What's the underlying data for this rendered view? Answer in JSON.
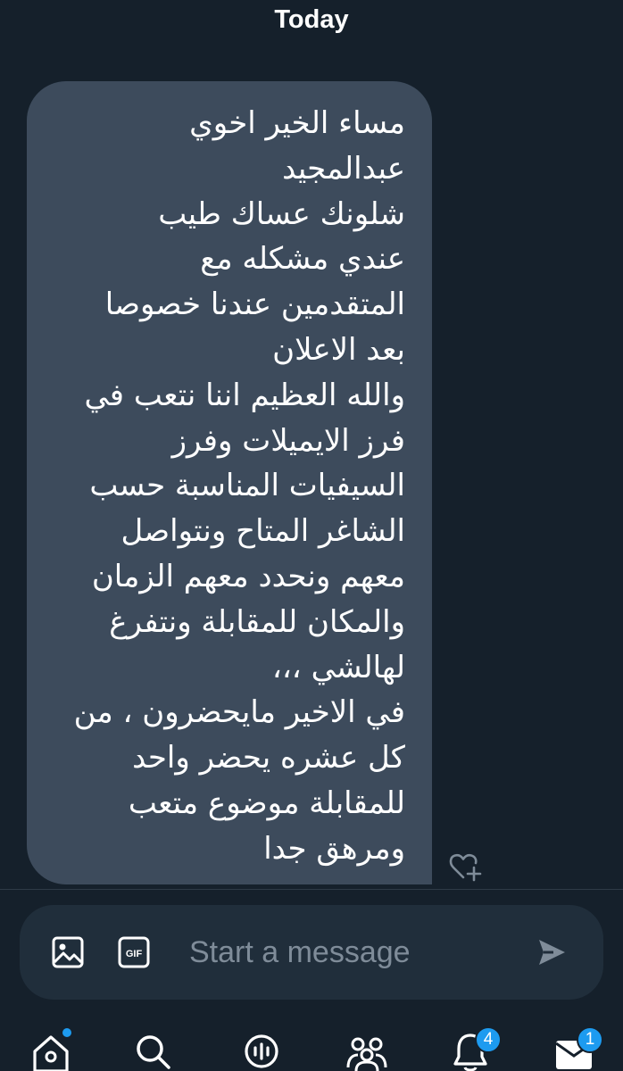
{
  "header": {
    "date_label": "Today"
  },
  "message": {
    "text": "مساء الخير اخوي\nعبدالمجيد\nشلونك عساك طيب\nعندي مشكله مع\nالمتقدمين عندنا خصوصا\nبعد الاعلان\nوالله العظيم اننا نتعب في\nفرز الايميلات وفرز\nالسيفيات المناسبة حسب\nالشاغر المتاح ونتواصل\nمعهم ونحدد معهم الزمان\nوالمكان للمقابلة ونتفرغ\nلهالشي ،،،\nفي الاخير مايحضرون ، من\nكل عشره يحضر واحد\nللمقابلة موضوع متعب\nومرهق جدا",
    "bubble_color": "#3d4b5c"
  },
  "composer": {
    "placeholder": "Start a message",
    "gif_label": "GIF",
    "icons": [
      "image-icon",
      "gif-icon",
      "send-icon"
    ]
  },
  "nav": {
    "items": [
      {
        "name": "home",
        "icon": "home-icon",
        "has_dot": true
      },
      {
        "name": "search",
        "icon": "search-icon"
      },
      {
        "name": "spaces",
        "icon": "spaces-icon"
      },
      {
        "name": "communities",
        "icon": "communities-icon"
      },
      {
        "name": "notifications",
        "icon": "bell-icon",
        "badge": "4"
      },
      {
        "name": "messages",
        "icon": "mail-icon",
        "badge": "1"
      }
    ]
  },
  "colors": {
    "background": "#15202b",
    "accent": "#1d9bf0",
    "composer_bg": "#202e3b",
    "muted": "#7f8c99"
  }
}
